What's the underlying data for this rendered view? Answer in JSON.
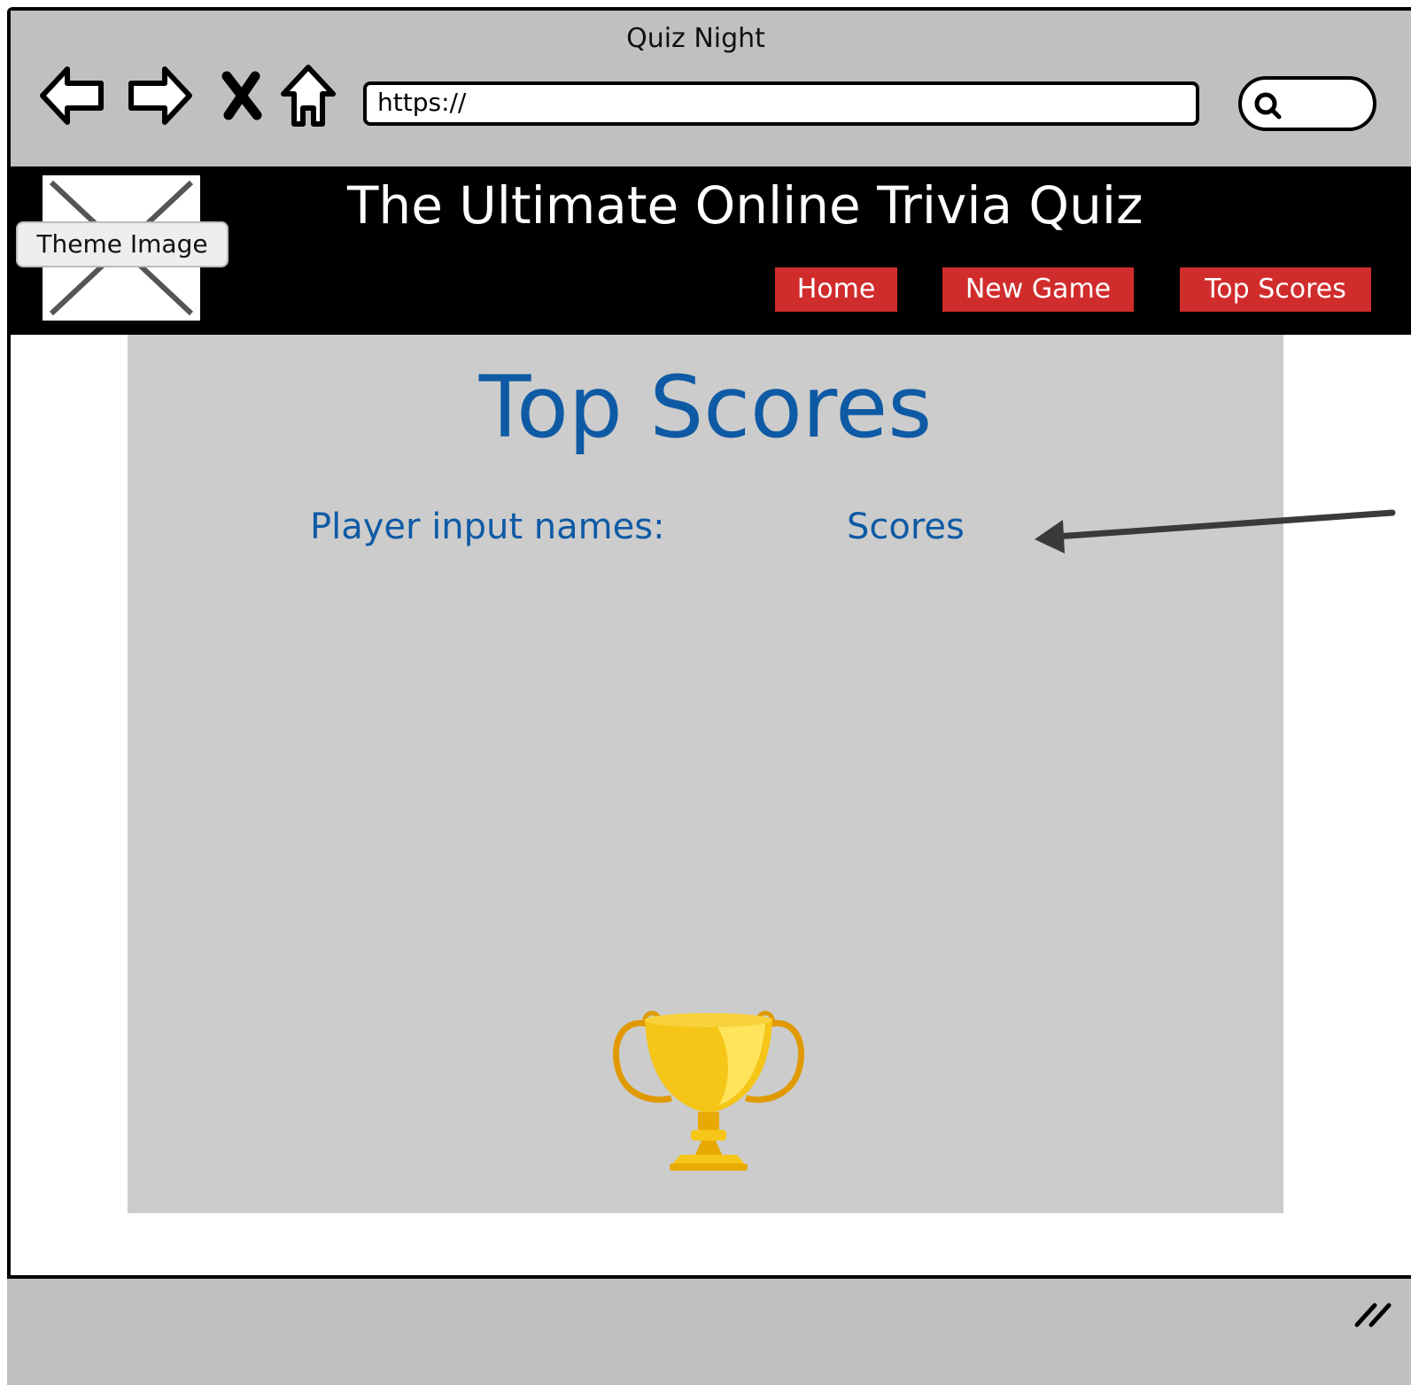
{
  "window": {
    "title": "Quiz Night"
  },
  "browser": {
    "url": "https://",
    "icons": [
      "back-arrow-icon",
      "forward-arrow-icon",
      "close-icon",
      "home-icon",
      "search-icon"
    ]
  },
  "header": {
    "theme_image_label": "Theme Image",
    "site_title": "The Ultimate Online Trivia Quiz",
    "nav": [
      {
        "label": "Home"
      },
      {
        "label": "New Game"
      },
      {
        "label": "Top Scores"
      }
    ]
  },
  "main": {
    "title": "Top Scores",
    "columns": {
      "player": "Player input names:",
      "scores": "Scores"
    },
    "trophy_icon": "trophy-icon"
  },
  "colors": {
    "chrome": "#c0c0c0",
    "header_bg": "#000000",
    "nav_button": "#d12c2c",
    "panel": "#cccccc",
    "heading_blue": "#0e5aa5",
    "trophy_gold": "#f5c518"
  }
}
